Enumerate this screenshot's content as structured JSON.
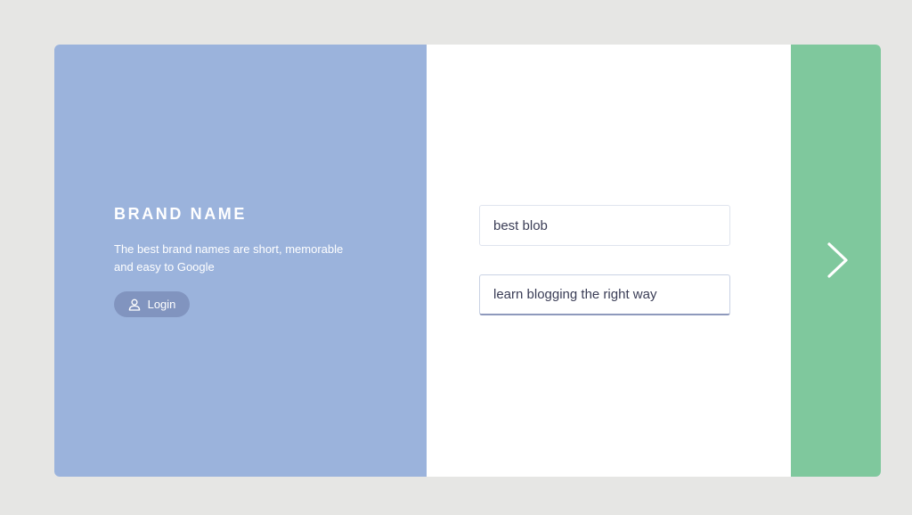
{
  "brand": {
    "title": "BRAND NAME",
    "description": "The best brand names are short, memorable and easy to Google",
    "login_label": "Login"
  },
  "form": {
    "field_1_value": "best blob",
    "field_2_value": "learn blogging the right way"
  },
  "icons": {
    "login": "user-icon",
    "next": "chevron-right-icon"
  },
  "colors": {
    "page_background": "#e6e6e4",
    "left_panel": "#9bb3dc",
    "login_button": "#8194bf",
    "right_panel": "#7fc89d",
    "input_text": "#3a3d56"
  }
}
